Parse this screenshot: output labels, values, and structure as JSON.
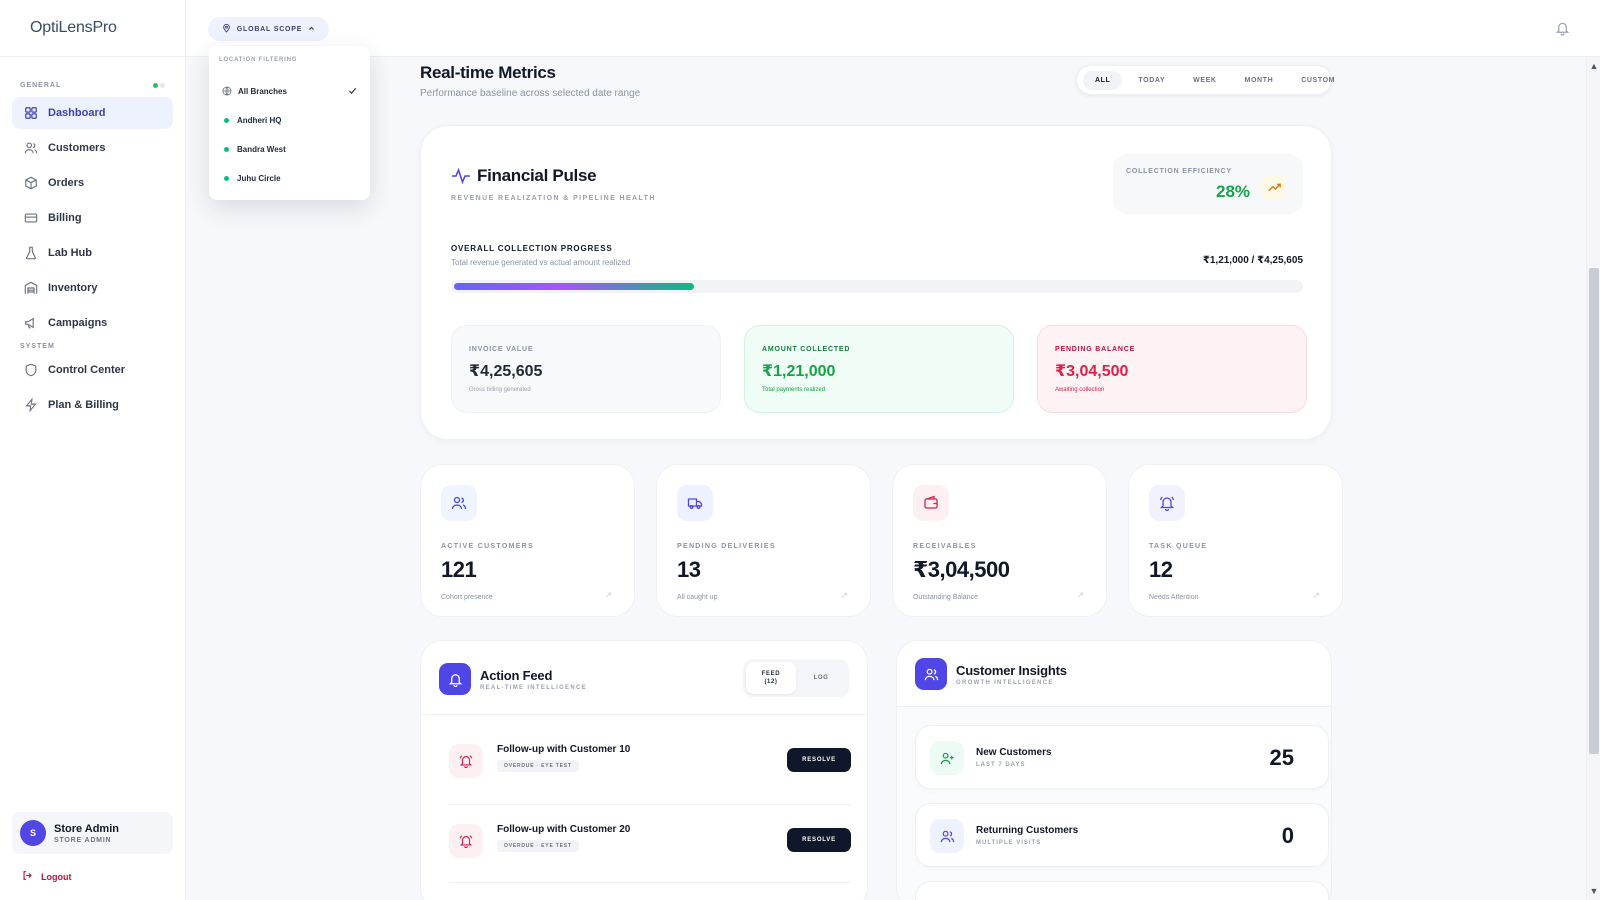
{
  "app": {
    "brand": "OptiLensPro"
  },
  "sidebar": {
    "general_label": "GENERAL",
    "system_label": "SYSTEM",
    "items": [
      {
        "label": "Dashboard",
        "icon": "grid-icon",
        "active": true
      },
      {
        "label": "Customers",
        "icon": "users-icon"
      },
      {
        "label": "Orders",
        "icon": "box-icon"
      },
      {
        "label": "Billing",
        "icon": "card-icon"
      },
      {
        "label": "Lab Hub",
        "icon": "flask-icon"
      },
      {
        "label": "Inventory",
        "icon": "warehouse-icon"
      },
      {
        "label": "Campaigns",
        "icon": "megaphone-icon"
      }
    ],
    "system_items": [
      {
        "label": "Control Center",
        "icon": "shield-icon"
      },
      {
        "label": "Plan & Billing",
        "icon": "bolt-icon"
      }
    ],
    "user": {
      "initial": "S",
      "name": "Store Admin",
      "role": "STORE ADMIN"
    },
    "logout_label": "Logout"
  },
  "topbar": {
    "scope_label": "GLOBAL SCOPE"
  },
  "location_dropdown": {
    "title": "LOCATION FILTERING",
    "items": [
      {
        "label": "All Branches",
        "selected": true
      },
      {
        "label": "Andheri HQ"
      },
      {
        "label": "Bandra West"
      },
      {
        "label": "Juhu Circle"
      }
    ]
  },
  "header": {
    "title": "Real-time Metrics",
    "subtitle": "Performance baseline across selected date range",
    "ranges": [
      "ALL",
      "TODAY",
      "WEEK",
      "MONTH",
      "CUSTOM"
    ],
    "active_range": "ALL"
  },
  "financial": {
    "title": "Financial Pulse",
    "subtitle": "REVENUE REALIZATION & PIPELINE HEALTH",
    "efficiency_label": "COLLECTION EFFICIENCY",
    "efficiency_value": "28%",
    "progress_title": "OVERALL COLLECTION PROGRESS",
    "progress_subtitle": "Total revenue generated vs actual amount realized",
    "progress_amount": "₹1,21,000 / ₹4,25,605",
    "progress_fraction": 0.284,
    "stats": [
      {
        "label": "INVOICE VALUE",
        "value": "₹4,25,605",
        "note": "Gross billing generated"
      },
      {
        "label": "AMOUNT COLLECTED",
        "value": "₹1,21,000",
        "note": "Total payments realized"
      },
      {
        "label": "PENDING BALANCE",
        "value": "₹3,04,500",
        "note": "Awaiting collection"
      }
    ],
    "colors": {
      "collected": "#16a34a",
      "pending": "#e11d48",
      "accent": "#4f46e5"
    }
  },
  "kpis": [
    {
      "label": "ACTIVE CUSTOMERS",
      "value": "121",
      "note": "Cohort presence",
      "icon": "users-icon"
    },
    {
      "label": "PENDING DELIVERIES",
      "value": "13",
      "note": "All caught up",
      "icon": "truck-icon"
    },
    {
      "label": "RECEIVABLES",
      "value": "₹3,04,500",
      "note": "Outstanding Balance",
      "icon": "wallet-icon"
    },
    {
      "label": "TASK QUEUE",
      "value": "12",
      "note": "Needs Attention",
      "icon": "bell-icon"
    }
  ],
  "action_feed": {
    "title": "Action Feed",
    "subtitle": "REAL-TIME INTELLIGENCE",
    "tab_feed": "FEED",
    "tab_feed_count": "(12)",
    "tab_log": "LOG",
    "items": [
      {
        "title": "Follow-up with Customer 10",
        "tag": "OVERDUE · EYE TEST",
        "action": "RESOLVE"
      },
      {
        "title": "Follow-up with Customer 20",
        "tag": "OVERDUE · EYE TEST",
        "action": "RESOLVE"
      }
    ]
  },
  "insights": {
    "title": "Customer Insights",
    "subtitle": "GROWTH INTELLIGENCE",
    "items": [
      {
        "title": "New Customers",
        "sub": "LAST 7 DAYS",
        "value": "25"
      },
      {
        "title": "Returning Customers",
        "sub": "MULTIPLE VISITS",
        "value": "0"
      }
    ]
  }
}
